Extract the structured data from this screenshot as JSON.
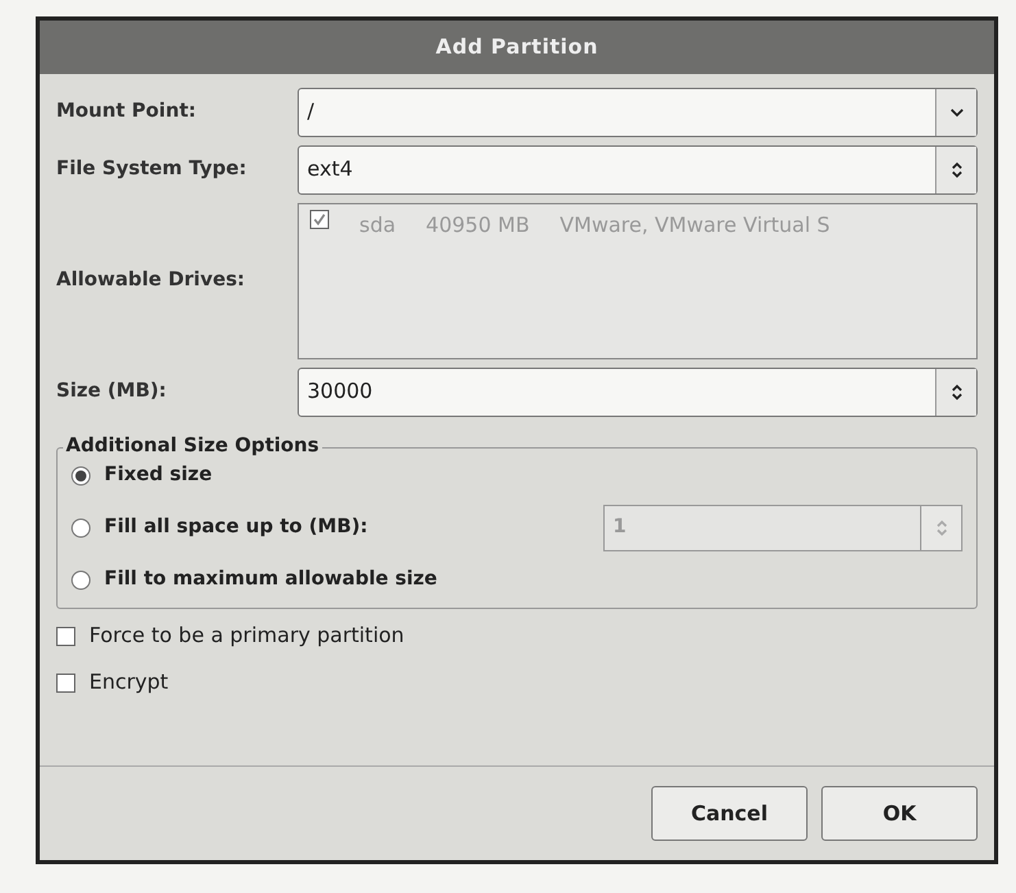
{
  "window": {
    "title": "Add Partition"
  },
  "mount_point": {
    "label": "Mount Point:",
    "value": "/"
  },
  "file_system_type": {
    "label": "File System Type:",
    "value": "ext4"
  },
  "allowable_drives": {
    "label": "Allowable Drives:",
    "disabled": true,
    "drives": [
      {
        "checked": true,
        "name": "sda",
        "size": "40950 MB",
        "model": "VMware, VMware Virtual S"
      }
    ]
  },
  "size": {
    "label": "Size (MB):",
    "value": "30000"
  },
  "additional_size_options": {
    "title": "Additional Size Options",
    "options": [
      {
        "label": "Fixed size",
        "selected": true
      },
      {
        "label": "Fill all space up to (MB):",
        "selected": false,
        "spin": {
          "value": "1",
          "disabled": true
        }
      },
      {
        "label": "Fill to maximum allowable size",
        "selected": false
      }
    ]
  },
  "checkboxes": [
    {
      "label": "Force to be a primary partition",
      "checked": false
    },
    {
      "label": "Encrypt",
      "checked": false
    }
  ],
  "buttons": [
    "Cancel",
    "OK"
  ]
}
